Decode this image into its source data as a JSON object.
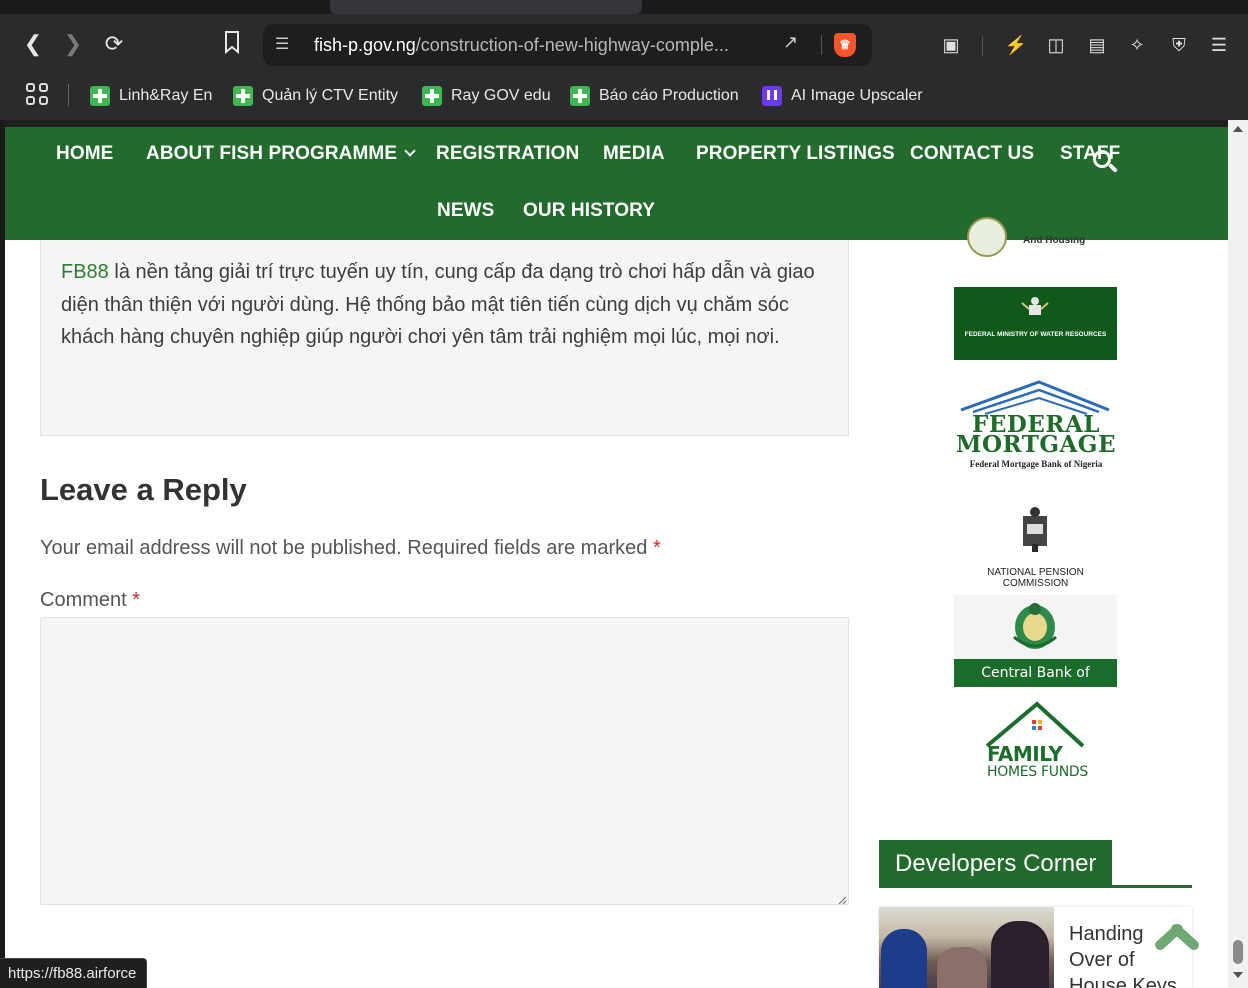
{
  "browser": {
    "url_host": "fish-p.gov.ng",
    "url_path": "/construction-of-new-highway-comple...",
    "bookmarks": [
      {
        "label": "Linh&Ray En"
      },
      {
        "label": "Quản lý CTV Entity"
      },
      {
        "label": "Ray GOV edu"
      },
      {
        "label": "Báo cáo Production"
      },
      {
        "label": "AI Image Upscaler"
      }
    ],
    "status_url": "https://fb88.airforce"
  },
  "nav": {
    "items": [
      "HOME",
      "ABOUT FISH PROGRAMME",
      "REGISTRATION",
      "MEDIA",
      "PROPERTY LISTINGS",
      "CONTACT US",
      "STAFF",
      "NEWS",
      "OUR HISTORY"
    ],
    "color": "#236b2c"
  },
  "post": {
    "link": "FB88",
    "text": " là nền tảng giải trí trực tuyến uy tín, cung cấp đa dạng trò chơi hấp dẫn và giao diện thân thiện với người dùng. Hệ thống bảo mật tiên tiến cùng dịch vụ chăm sóc khách hàng chuyên nghiệp giúp người chơi yên tâm trải nghiệm mọi lúc, mọi nơi."
  },
  "reply": {
    "title": "Leave a Reply",
    "note": "Your email address will not be published. Required fields are marked",
    "required_mark": "*",
    "comment_label": "Comment",
    "comment_value": ""
  },
  "sidebar": {
    "logos": {
      "housing_text": "And Housing",
      "water_text": "FEDERAL MINISTRY OF WATER RESOURCES",
      "fmbn_line1": "FEDERAL",
      "fmbn_line2": "MORTGAGE",
      "fmbn_small": "Federal Mortgage Bank of Nigeria",
      "pencom_text": "NATIONAL PENSION COMMISSION",
      "cbn_text": "Central Bank of Nigeria",
      "ffh_line1": "FAMILY",
      "ffh_line2": "HOMES FUNDS"
    },
    "developers_heading": "Developers Corner",
    "card_title": "Handing Over of House Keys"
  }
}
